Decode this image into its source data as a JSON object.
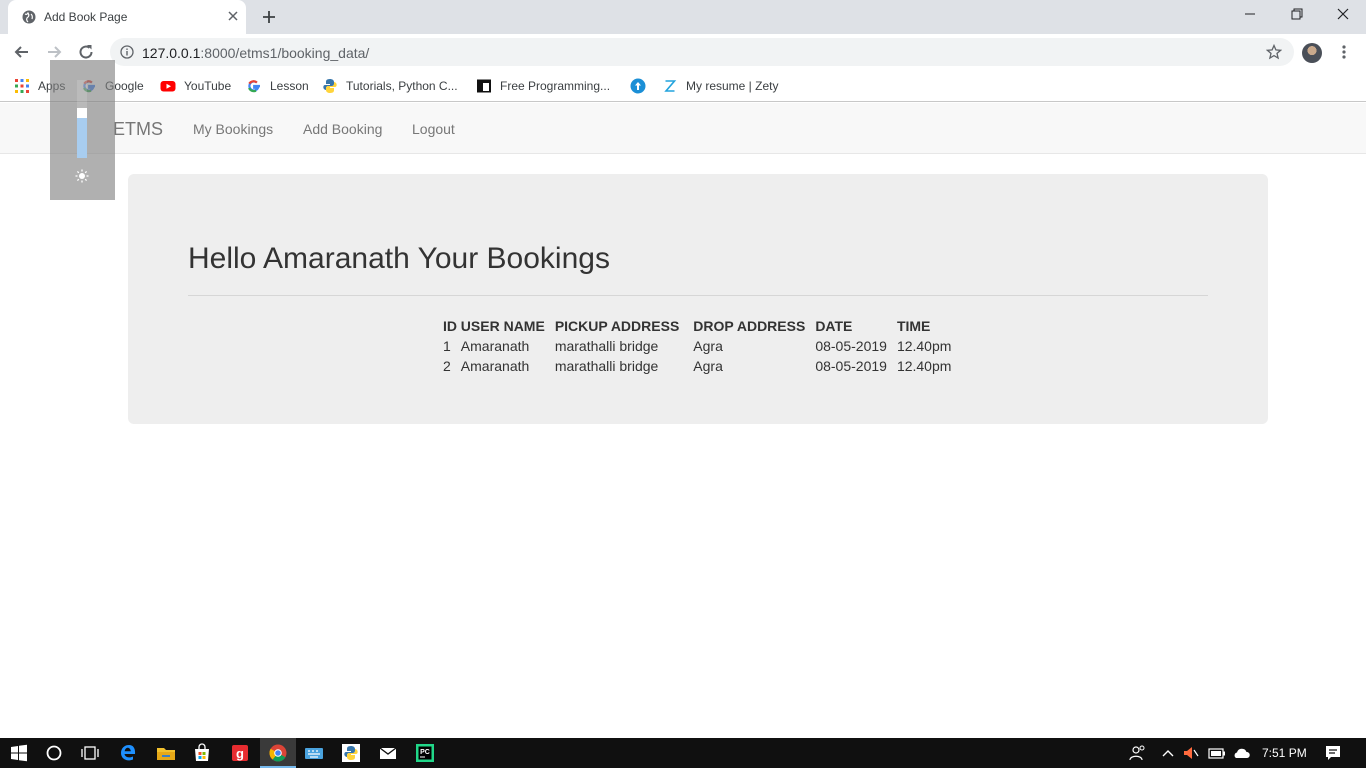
{
  "browser": {
    "tab_title": "Add Book Page",
    "url_host": "127.0.0.1",
    "url_path": ":8000/etms1/booking_data/"
  },
  "bookmarks": [
    {
      "label": "Apps",
      "icon": "apps-grid-icon"
    },
    {
      "label": "Google",
      "icon": "google-icon"
    },
    {
      "label": "YouTube",
      "icon": "youtube-icon"
    },
    {
      "label": "Lesson",
      "icon": "google-icon"
    },
    {
      "label": "Tutorials, Python C...",
      "icon": "python-icon"
    },
    {
      "label": "Free Programming...",
      "icon": "window-icon"
    },
    {
      "label": "",
      "icon": "upload-circle-icon"
    },
    {
      "label": "My resume | Zety",
      "icon": "zety-icon"
    }
  ],
  "navbar": {
    "brand": "ETMS",
    "links": [
      "My Bookings",
      "Add Booking",
      "Logout"
    ]
  },
  "main": {
    "heading": "Hello Amaranath Your Bookings",
    "table": {
      "headers": [
        "ID",
        "USER NAME",
        "PICKUP ADDRESS",
        "DROP ADDRESS",
        "DATE",
        "TIME"
      ],
      "rows": [
        [
          "1",
          "Amaranath",
          "marathalli bridge",
          "Agra",
          "08-05-2019",
          "12.40pm"
        ],
        [
          "2",
          "Amaranath",
          "marathalli bridge",
          "Agra",
          "08-05-2019",
          "12.40pm"
        ]
      ]
    }
  },
  "taskbar": {
    "time": "7:51 PM"
  },
  "colors": {
    "tabstrip": "#dee1e6",
    "navbar": "#f8f8f8",
    "jumbotron": "#eeeeee",
    "taskbar": "#101010"
  }
}
